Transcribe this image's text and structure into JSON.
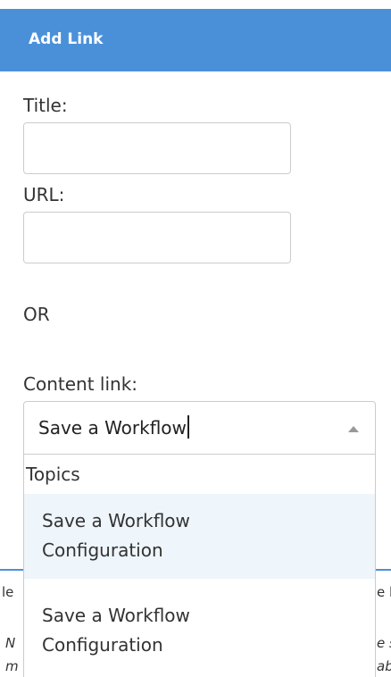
{
  "background_fragments": {
    "row_left": "le",
    "row_right": "e l",
    "italic_left_1": "N",
    "italic_left_2": "m",
    "italic_right_1": "e s",
    "italic_right_2": "ab"
  },
  "dialog": {
    "title": "Add Link",
    "title_label": "Title:",
    "title_value": "",
    "url_label": "URL:",
    "url_value": "",
    "or_text": "OR",
    "content_link_label": "Content link:",
    "content_link_value": "Save a Workflow"
  },
  "dropdown": {
    "group_label": "Topics",
    "options": [
      {
        "line1": "Save a Workflow",
        "line2": "Configuration",
        "highlighted": true
      },
      {
        "line1": "Save a Workflow",
        "line2": "Configuration",
        "highlighted": false
      }
    ]
  },
  "colors": {
    "header": "#4a90d9",
    "highlight": "#eef5fb",
    "border": "#cccccc"
  }
}
